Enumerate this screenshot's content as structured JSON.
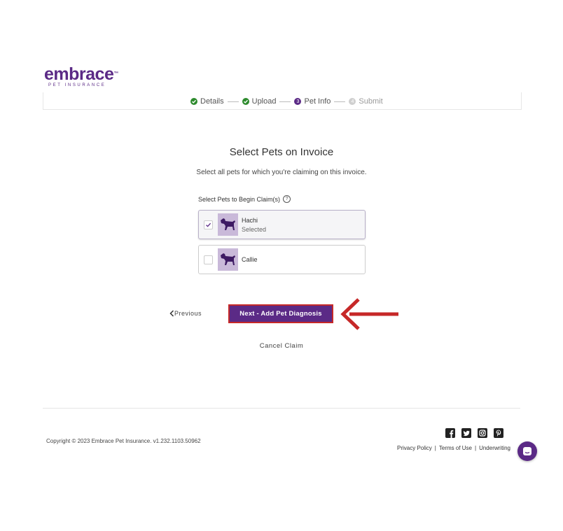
{
  "brand": {
    "name": "embrace",
    "tm": "™",
    "tagline": "PET INSURANCE",
    "color": "#5b2a86"
  },
  "stepper": {
    "steps": [
      {
        "label": "Details",
        "state": "done"
      },
      {
        "label": "Upload",
        "state": "done"
      },
      {
        "label": "Pet Info",
        "state": "current",
        "number": "3"
      },
      {
        "label": "Submit",
        "state": "pending",
        "number": "4"
      }
    ]
  },
  "page": {
    "title": "Select Pets on Invoice",
    "subtitle": "Select all pets for which you're claiming on this invoice.",
    "section_label": "Select Pets to Begin Claim(s)",
    "help_icon": "?"
  },
  "pets": [
    {
      "name": "Hachi",
      "status": "Selected",
      "checked": true
    },
    {
      "name": "Callie",
      "status": "",
      "checked": false
    }
  ],
  "actions": {
    "previous": "Previous",
    "next": "Next - Add Pet Diagnosis",
    "cancel": "Cancel Claim"
  },
  "footer": {
    "copyright": "Copyright © 2023   Embrace Pet Insurance. v1.232.1103.50962",
    "links": [
      "Privacy Policy",
      "Terms of Use",
      "Underwriting"
    ],
    "social": [
      "facebook-icon",
      "twitter-icon",
      "instagram-icon",
      "pinterest-icon"
    ]
  },
  "colors": {
    "accent": "#5b2a86",
    "done": "#2e8b2e",
    "annotation": "#c62828"
  }
}
